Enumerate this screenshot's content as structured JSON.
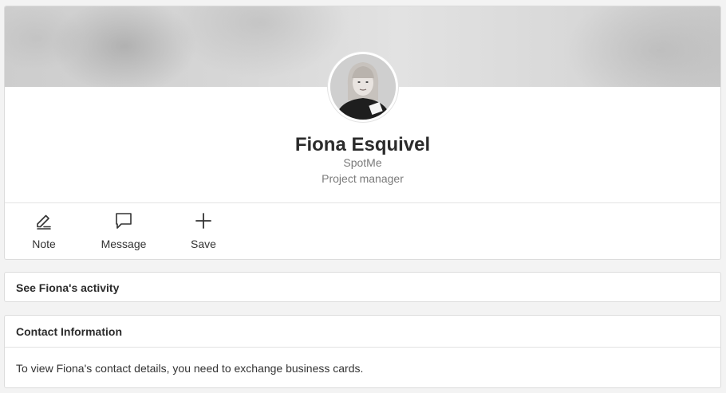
{
  "profile": {
    "name": "Fiona Esquivel",
    "company": "SpotMe",
    "role": "Project manager",
    "avatar_icon": "user-photo"
  },
  "actions": [
    {
      "label": "Note",
      "icon": "note-edit-icon"
    },
    {
      "label": "Message",
      "icon": "message-bubble-icon"
    },
    {
      "label": "Save",
      "icon": "plus-icon"
    }
  ],
  "activity": {
    "title": "See Fiona's activity"
  },
  "contact": {
    "title": "Contact Information",
    "body": "To view Fiona's contact details, you need to exchange business cards."
  },
  "colors": {
    "background": "#f3f3f3",
    "card": "#ffffff",
    "border": "#dcdcdc",
    "text": "#2b2b2b",
    "muted": "#7a7a7a"
  }
}
